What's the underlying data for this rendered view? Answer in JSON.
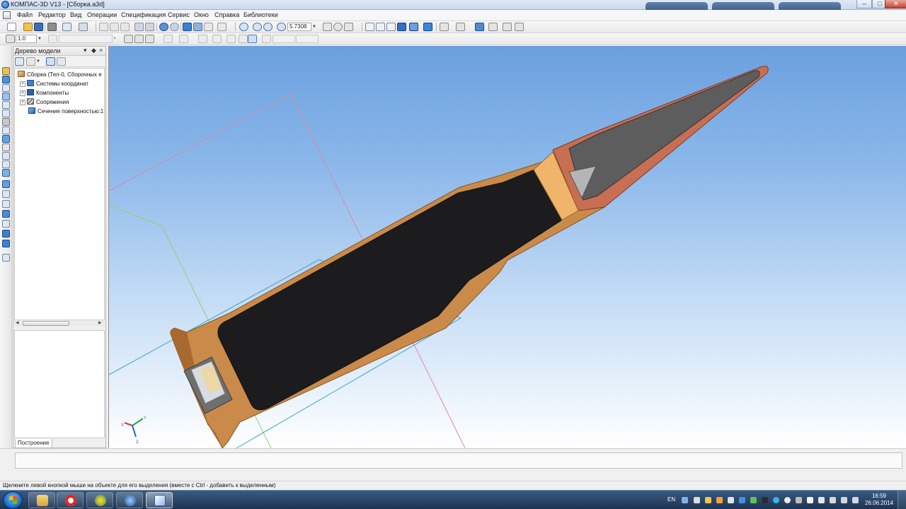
{
  "window": {
    "title": "КОМПАС-3D V13 - [Сборка.a3d]",
    "buttons": [
      "–",
      "□",
      "✕"
    ]
  },
  "menu": {
    "items": [
      "Файл",
      "Редактор",
      "Вид",
      "Операции",
      "Спецификация",
      "Сервис",
      "Окно",
      "Справка",
      "Библиотеки"
    ]
  },
  "toolbar": {
    "zoom_value": "5.7308",
    "step_value": "1.0"
  },
  "model_tree": {
    "title": "Дерево модели",
    "items": [
      {
        "label": "Сборка (Тел-0, Сборочных е",
        "icon": "assembly-icon"
      },
      {
        "label": "Системы координат",
        "icon": "coordinate-systems-icon"
      },
      {
        "label": "Компоненты",
        "icon": "components-icon"
      },
      {
        "label": "Сопряжения",
        "icon": "mates-icon"
      },
      {
        "label": "Сечение поверхностью:1",
        "icon": "section-icon"
      }
    ],
    "tab_label": "Построение"
  },
  "viewport": {
    "axis_labels": {
      "x": "X",
      "y": "Y",
      "z": "Z"
    }
  },
  "status": {
    "message": "Щелкните левой кнопкой мыши на объекте для его выделения (вместе с Ctrl - добавить к выделенным)"
  },
  "taskbar": {
    "language": "EN",
    "time": "16:59",
    "date": "26.06.2014",
    "apps": [
      "file-explorer-icon",
      "yandex-browser-icon",
      "media-player-icon",
      "kompas-launcher-icon",
      "kompas-3d-icon"
    ]
  },
  "colors": {
    "brass": "#c98a4a",
    "brass_dark": "#9c6430",
    "powder": "#1c1c1e",
    "bullet_core": "#5d5d5d",
    "jacket": "#c86e52",
    "viewport_top": "#6aa0df"
  }
}
